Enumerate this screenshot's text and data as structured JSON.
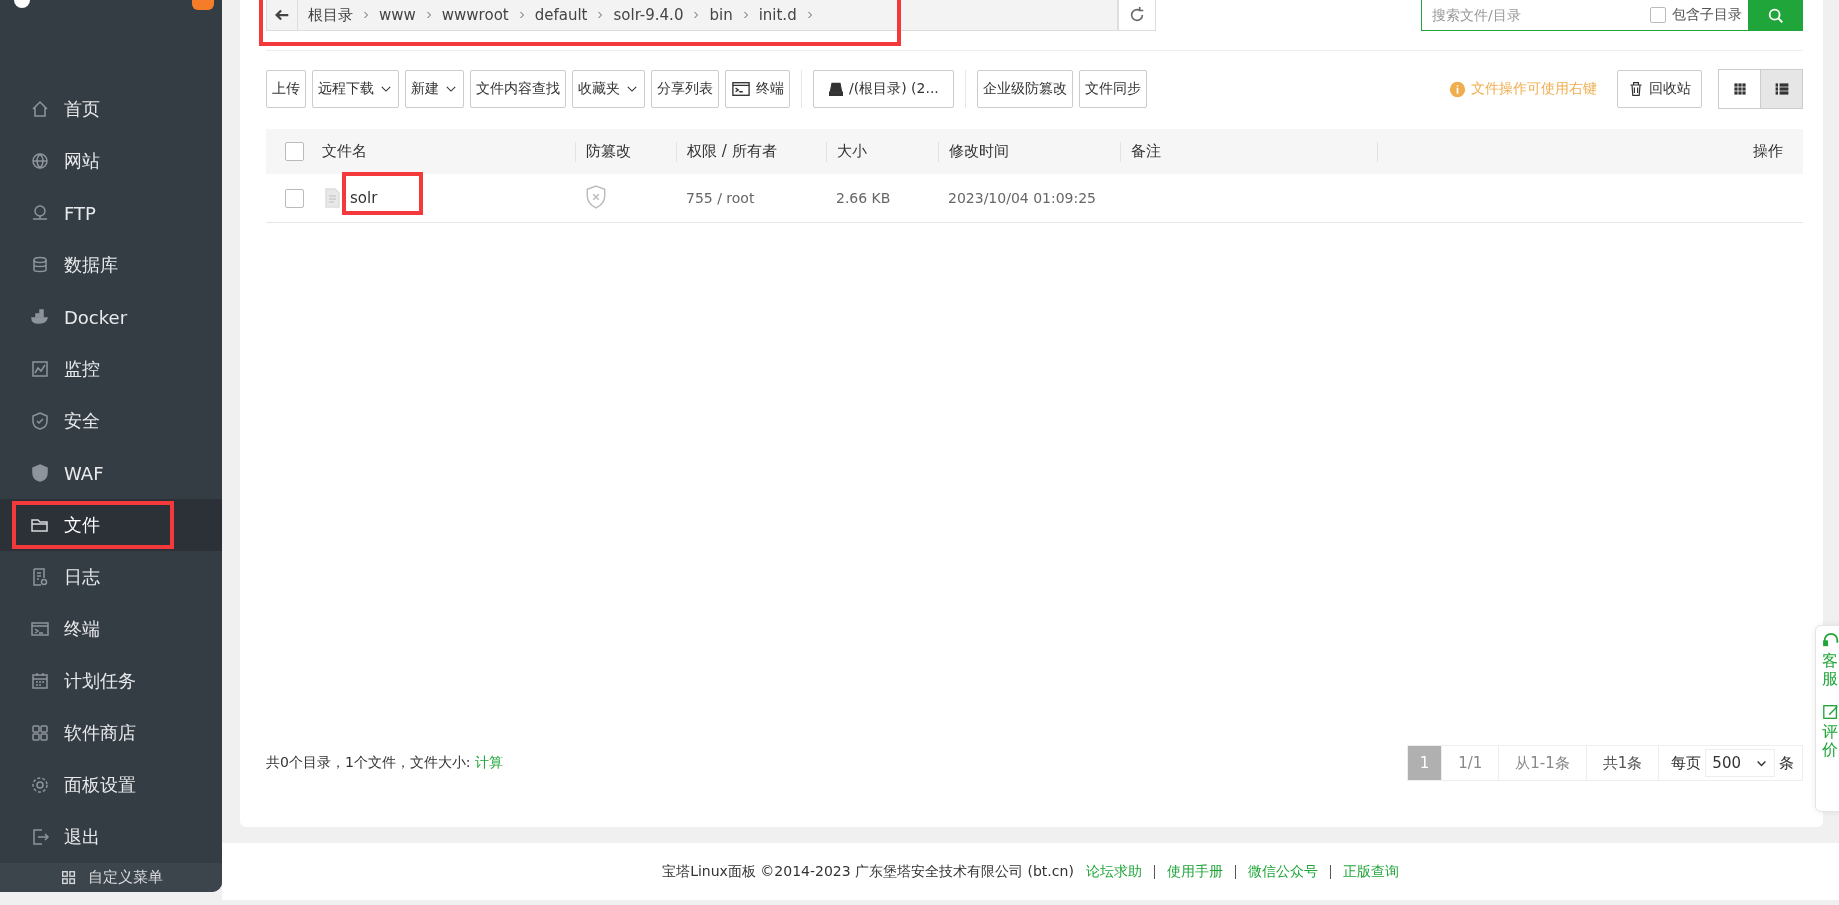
{
  "sidebar": {
    "items": [
      {
        "label": "首页",
        "selected": false,
        "highlighted": false
      },
      {
        "label": "网站",
        "selected": false,
        "highlighted": false
      },
      {
        "label": "FTP",
        "selected": false,
        "highlighted": false
      },
      {
        "label": "数据库",
        "selected": false,
        "highlighted": false
      },
      {
        "label": "Docker",
        "selected": false,
        "highlighted": false
      },
      {
        "label": "监控",
        "selected": false,
        "highlighted": false
      },
      {
        "label": "安全",
        "selected": false,
        "highlighted": false
      },
      {
        "label": "WAF",
        "selected": false,
        "highlighted": false
      },
      {
        "label": "文件",
        "selected": true,
        "highlighted": true
      },
      {
        "label": "日志",
        "selected": false,
        "highlighted": false
      },
      {
        "label": "终端",
        "selected": false,
        "highlighted": false
      },
      {
        "label": "计划任务",
        "selected": false,
        "highlighted": false
      },
      {
        "label": "软件商店",
        "selected": false,
        "highlighted": false
      },
      {
        "label": "面板设置",
        "selected": false,
        "highlighted": false
      },
      {
        "label": "退出",
        "selected": false,
        "highlighted": false
      }
    ],
    "custom_menu": "自定义菜单"
  },
  "breadcrumb": {
    "highlighted": true,
    "segments": [
      "根目录",
      "www",
      "wwwroot",
      "default",
      "solr-9.4.0",
      "bin",
      "init.d"
    ]
  },
  "search": {
    "placeholder": "搜索文件/目录",
    "include_subdirs": {
      "label": "包含子目录",
      "checked": false
    }
  },
  "toolbar": {
    "groups": [
      [
        {
          "label": "上传",
          "kind": "button"
        },
        {
          "label": "远程下载",
          "kind": "dropdown"
        },
        {
          "label": "新建",
          "kind": "dropdown"
        },
        {
          "label": "文件内容查找",
          "kind": "button"
        },
        {
          "label": "收藏夹",
          "kind": "dropdown"
        },
        {
          "label": "分享列表",
          "kind": "button"
        },
        {
          "label": "终端",
          "kind": "terminal"
        }
      ],
      [
        {
          "label": "/(根目录) (2...",
          "kind": "disk"
        }
      ],
      [
        {
          "label": "企业级防篡改",
          "kind": "button"
        },
        {
          "label": "文件同步",
          "kind": "button"
        }
      ]
    ],
    "hint": "文件操作可使用右键",
    "recycle_bin": "回收站",
    "view_modes": [
      {
        "kind": "grid",
        "selected": false
      },
      {
        "kind": "list",
        "selected": true
      }
    ]
  },
  "table": {
    "select_all": {
      "checked": false
    },
    "columns": [
      "文件名",
      "防篡改",
      "权限 / 所有者",
      "大小",
      "修改时间",
      "备注",
      "操作"
    ],
    "rows": [
      {
        "checked": false,
        "name": "solr",
        "name_highlighted": true,
        "protected": false,
        "permissions": "755 / root",
        "size": "2.66 KB",
        "modified": "2023/10/04 01:09:25"
      }
    ]
  },
  "summary": {
    "text": "共0个目录，1个文件，文件大小:",
    "link": "计算"
  },
  "pagination": {
    "pages": [
      {
        "label": "1",
        "selected": true
      }
    ],
    "page_info": "1/1",
    "range": "从1-1条",
    "total": "共1条",
    "per_page_label": "每页",
    "per_page": "500",
    "unit": "条"
  },
  "side_float": {
    "items": [
      "客服",
      "评价"
    ]
  },
  "footer": {
    "copyright": "宝塔Linux面板 ©2014-2023 广东堡塔安全技术有限公司 (bt.cn)",
    "links": [
      "论坛求助",
      "使用手册",
      "微信公众号",
      "正版查询"
    ]
  }
}
